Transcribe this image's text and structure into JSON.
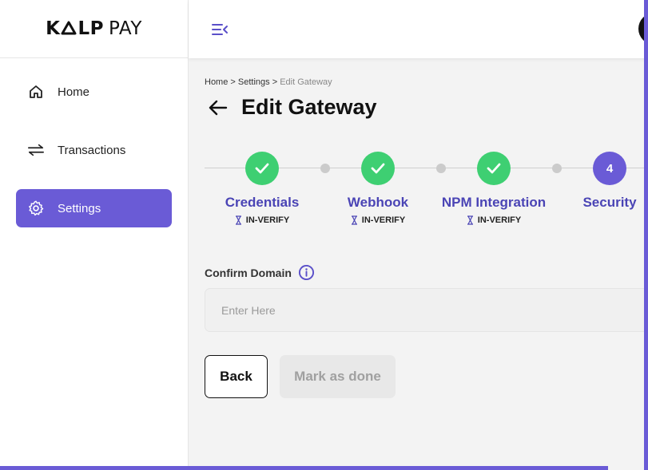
{
  "app": {
    "logo_text_strong": "K",
    "logo_text_strong2": "LP",
    "logo_text_light": "PAY"
  },
  "sidebar": {
    "items": [
      {
        "label": "Home",
        "icon": "home-icon",
        "active": false
      },
      {
        "label": "Transactions",
        "icon": "transfer-arrows-icon",
        "active": false
      },
      {
        "label": "Settings",
        "icon": "gear-icon",
        "active": true
      }
    ]
  },
  "breadcrumb": {
    "items": [
      "Home",
      "Settings"
    ],
    "separator": ">",
    "current": "Edit Gateway"
  },
  "page": {
    "title": "Edit Gateway"
  },
  "stepper": {
    "steps": [
      {
        "label": "Credentials",
        "status": "IN-VERIFY",
        "state": "done"
      },
      {
        "label": "Webhook",
        "status": "IN-VERIFY",
        "state": "done"
      },
      {
        "label": "NPM Integration",
        "status": "IN-VERIFY",
        "state": "done"
      },
      {
        "label": "Security",
        "number": "4",
        "state": "current"
      }
    ]
  },
  "form": {
    "confirm_domain": {
      "label": "Confirm Domain",
      "placeholder": "Enter Here",
      "value": ""
    }
  },
  "actions": {
    "back_label": "Back",
    "done_label": "Mark as done"
  },
  "colors": {
    "accent": "#6a5bd6",
    "success": "#3ecf72",
    "step_label": "#4a44b5"
  }
}
